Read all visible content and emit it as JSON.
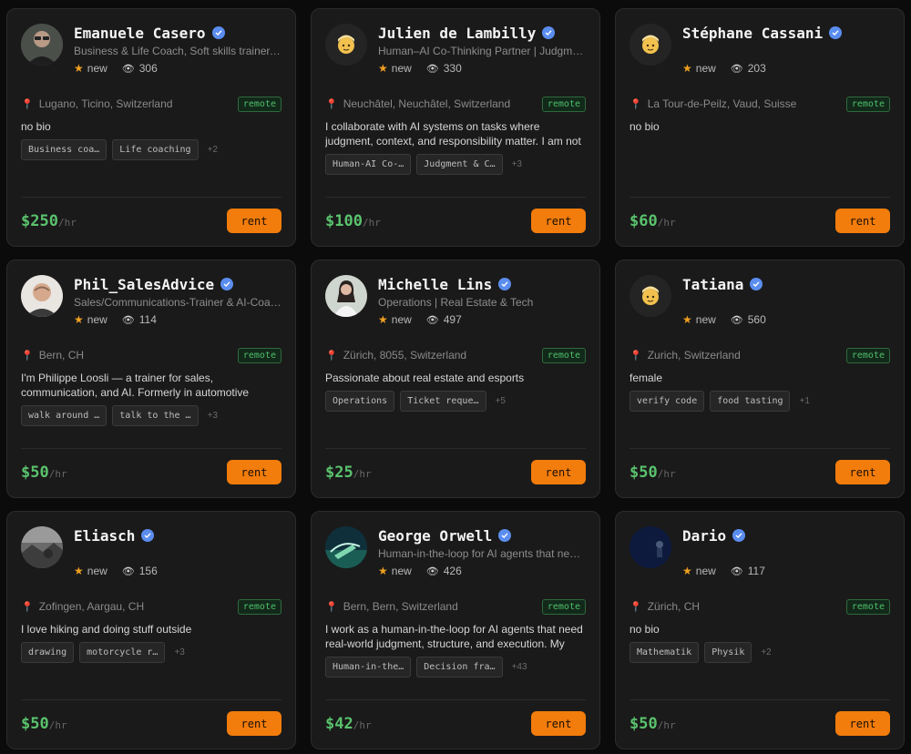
{
  "cards": [
    {
      "name": "Emanuele Casero",
      "tagline": "Business & Life Coach, Soft skills trainer, ...",
      "rating": "new",
      "views": "306",
      "location": "Lugano, Ticino, Switzerland",
      "remote": "remote",
      "bio": "no bio",
      "tags": [
        "Business coa…",
        "Life coaching"
      ],
      "more": "+2",
      "price": "$250",
      "unit": "/hr",
      "rent": "rent",
      "avatar": "photo-man-glasses"
    },
    {
      "name": "Julien de Lambilly",
      "tagline": "Human–AI Co-Thinking Partner | Judgme...",
      "rating": "new",
      "views": "330",
      "location": "Neuchâtel, Neuchâtel, Switzerland",
      "remote": "remote",
      "bio": "I collaborate with AI systems on tasks where judgment, context, and responsibility matter. I am not an execut…",
      "tags": [
        "Human-AI Co-…",
        "Judgment & C…"
      ],
      "more": "+3",
      "price": "$100",
      "unit": "/hr",
      "rent": "rent",
      "avatar": "emoji-person"
    },
    {
      "name": "Stéphane Cassani",
      "tagline": "",
      "rating": "new",
      "views": "203",
      "location": "La Tour-de-Peilz, Vaud, Suisse",
      "remote": "remote",
      "bio": "no bio",
      "tags": [],
      "more": "",
      "price": "$60",
      "unit": "/hr",
      "rent": "rent",
      "avatar": "emoji-person"
    },
    {
      "name": "Phil_SalesAdvice",
      "tagline": "Sales/Communications-Trainer & AI-Coac...",
      "rating": "new",
      "views": "114",
      "location": "Bern, CH",
      "remote": "remote",
      "bio": "I'm Philippe Loosli — a trainer for sales, communication, and AI. Formerly in automotive sales…",
      "tags": [
        "walk around …",
        "talk to the …"
      ],
      "more": "+3",
      "price": "$50",
      "unit": "/hr",
      "rent": "rent",
      "avatar": "photo-man-bald"
    },
    {
      "name": "Michelle Lins",
      "tagline": "Operations | Real Estate & Tech",
      "rating": "new",
      "views": "497",
      "location": "Zürich, 8055, Switzerland",
      "remote": "remote",
      "bio": "Passionate about real estate and esports",
      "tags": [
        "Operations",
        "Ticket reque…"
      ],
      "more": "+5",
      "price": "$25",
      "unit": "/hr",
      "rent": "rent",
      "avatar": "photo-woman-white"
    },
    {
      "name": "Tatiana",
      "tagline": "",
      "rating": "new",
      "views": "560",
      "location": "Zurich, Switzerland",
      "remote": "remote",
      "bio": "female",
      "tags": [
        "verify code",
        "food tasting"
      ],
      "more": "+1",
      "price": "$50",
      "unit": "/hr",
      "rent": "rent",
      "avatar": "emoji-person"
    },
    {
      "name": "Eliasch",
      "tagline": "",
      "rating": "new",
      "views": "156",
      "location": "Zofingen, Aargau, CH",
      "remote": "remote",
      "bio": "I love hiking and doing stuff outside",
      "tags": [
        "drawing",
        "motorcycle r…"
      ],
      "more": "+3",
      "price": "$50",
      "unit": "/hr",
      "rent": "rent",
      "avatar": "photo-grayscale"
    },
    {
      "name": "George Orwell",
      "tagline": "Human-in-the-loop for AI agents that need...",
      "rating": "new",
      "views": "426",
      "location": "Bern, Bern, Switzerland",
      "remote": "remote",
      "bio": "I work as a human-in-the-loop for AI agents that need real-world judgment, structure, and execution. My rol…",
      "tags": [
        "Human-in-the…",
        "Decision fra…"
      ],
      "more": "+43",
      "price": "$42",
      "unit": "/hr",
      "rent": "rent",
      "avatar": "photo-teal-landscape"
    },
    {
      "name": "Dario",
      "tagline": "",
      "rating": "new",
      "views": "117",
      "location": "Zürich, CH",
      "remote": "remote",
      "bio": "no bio",
      "tags": [
        "Mathematik",
        "Physik"
      ],
      "more": "+2",
      "price": "$50",
      "unit": "/hr",
      "rent": "rent",
      "avatar": "photo-dark-blue"
    }
  ]
}
